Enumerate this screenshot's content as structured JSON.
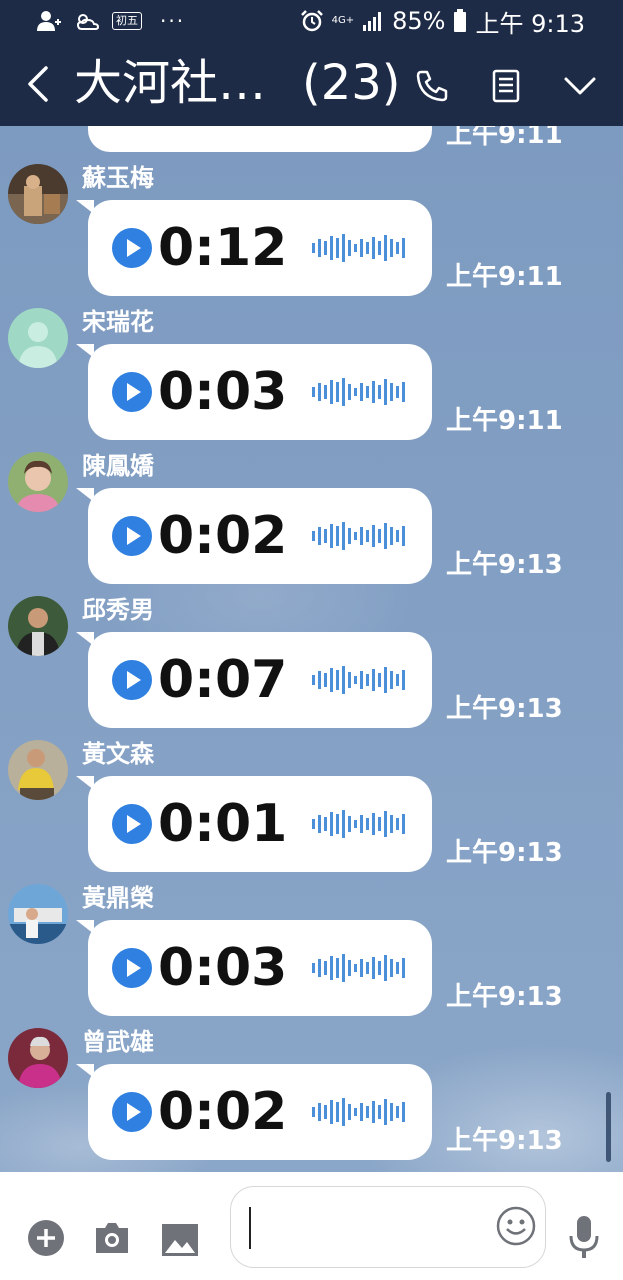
{
  "status_bar": {
    "lunar_badge": "初五",
    "dots": "···",
    "network": "4G+",
    "battery": "85%",
    "time": "上午 9:13"
  },
  "header": {
    "title": "大河社…",
    "member_count": "(23)"
  },
  "partial_message": {
    "time": "上午9:11"
  },
  "messages": [
    {
      "name": "蘇玉梅",
      "duration": "0:12",
      "time": "上午9:11"
    },
    {
      "name": "宋瑞花",
      "duration": "0:03",
      "time": "上午9:11"
    },
    {
      "name": "陳鳳嬌",
      "duration": "0:02",
      "time": "上午9:13"
    },
    {
      "name": "邱秀男",
      "duration": "0:07",
      "time": "上午9:13"
    },
    {
      "name": "黃文森",
      "duration": "0:01",
      "time": "上午9:13"
    },
    {
      "name": "黃鼎榮",
      "duration": "0:03",
      "time": "上午9:13"
    },
    {
      "name": "曾武雄",
      "duration": "0:02",
      "time": "上午9:13"
    }
  ],
  "input": {
    "value": ""
  },
  "colors": {
    "header": "#1e2b47",
    "chat_bg": "#7f9cc0",
    "play": "#2f80e0",
    "wave": "#4a8fd8"
  }
}
